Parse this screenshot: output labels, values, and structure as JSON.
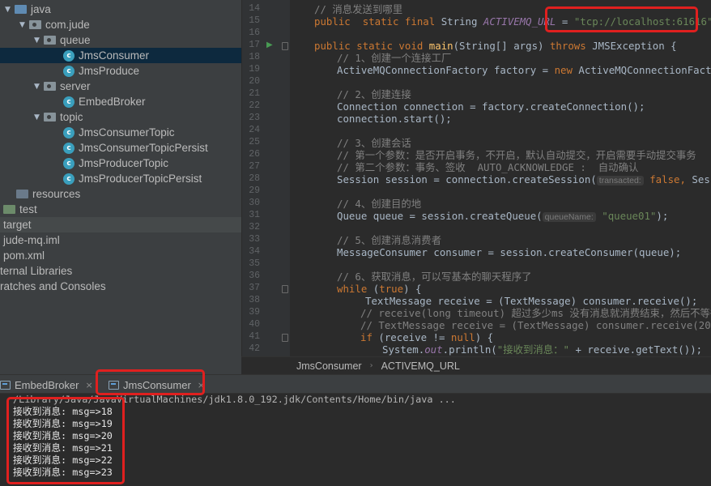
{
  "project_tree": [
    {
      "label": "java",
      "depth": 0,
      "icon": "source-folder-icon",
      "expanded": true
    },
    {
      "label": "com.jude",
      "depth": 1,
      "icon": "package-icon",
      "expanded": true
    },
    {
      "label": "queue",
      "depth": 2,
      "icon": "package-icon",
      "expanded": true
    },
    {
      "label": "JmsConsumer",
      "depth": 3,
      "icon": "java-class-icon",
      "selected": true
    },
    {
      "label": "JmsProduce",
      "depth": 3,
      "icon": "java-class-icon"
    },
    {
      "label": "server",
      "depth": 2,
      "icon": "package-icon",
      "expanded": true
    },
    {
      "label": "EmbedBroker",
      "depth": 3,
      "icon": "java-class-icon"
    },
    {
      "label": "topic",
      "depth": 2,
      "icon": "package-icon",
      "expanded": true
    },
    {
      "label": "JmsConsumerTopic",
      "depth": 3,
      "icon": "java-class-icon"
    },
    {
      "label": "JmsConsumerTopicPersist",
      "depth": 3,
      "icon": "java-class-icon"
    },
    {
      "label": "JmsProducerTopic",
      "depth": 3,
      "icon": "java-class-icon"
    },
    {
      "label": "JmsProducerTopicPersist",
      "depth": 3,
      "icon": "java-class-icon"
    },
    {
      "label": "resources",
      "depth": 0,
      "icon": "resources-folder-icon"
    },
    {
      "label": "test",
      "depth": -1,
      "icon": "test-folder-icon"
    },
    {
      "label": "target",
      "depth": -2
    },
    {
      "label": "jude-mq.iml",
      "depth": -2
    },
    {
      "label": "pom.xml",
      "depth": -2
    },
    {
      "label": "ternal Libraries",
      "depth": -3
    },
    {
      "label": "ratches and Consoles",
      "depth": -3
    }
  ],
  "editor": {
    "line_numbers": [
      "14",
      "15",
      "16",
      "17",
      "18",
      "19",
      "20",
      "21",
      "22",
      "23",
      "24",
      "25",
      "26",
      "27",
      "28",
      "29",
      "30",
      "31",
      "32",
      "33",
      "34",
      "35",
      "36",
      "37",
      "38",
      "39",
      "40",
      "41",
      "42"
    ],
    "code": {
      "l14": "// 消息发送到哪里",
      "l15_kw1": "public",
      "l15_kw2": "static final",
      "l15_type": "String",
      "l15_const": "ACTIVEMQ_URL",
      "l15_eq": " = ",
      "l15_str": "\"tcp://localhost:61616\"",
      "l15_end": ";",
      "l17_kw": "public static void",
      "l17_fn": "main",
      "l17_rest": "(String[] args)",
      "l17_throws": "throws",
      "l17_exc": "JMSException {",
      "l18": "// 1、创建一个连接工厂",
      "l19_a": "ActiveMQConnectionFactory factory = ",
      "l19_new": "new",
      "l19_b": " ActiveMQConnectionFactory(",
      "l21": "// 2、创建连接",
      "l22": "Connection connection = factory.createConnection();",
      "l23": "connection.start();",
      "l25": "// 3、创建会话",
      "l26": "// 第一个参数：是否开启事务，不开启，默认自动提交，开启需要手动提交事务",
      "l27": "// 第二个参数：事务、签收  AUTO_ACKNOWLEDGE :  自动确认",
      "l28_a": "Session session = connection.createSession(",
      "l28_hint": "transacted:",
      "l28_kw": "false,",
      "l28_b": " Sessio",
      "l30": "// 4、创建目的地",
      "l31_a": "Queue queue = session.createQueue(",
      "l31_hint": "queueName:",
      "l31_str": "\"queue01\"",
      "l31_b": ");",
      "l33": "// 5、创建消息消费者",
      "l34": "MessageConsumer consumer = session.createConsumer(queue);",
      "l36": "// 6、获取消息，可以写基本的聊天程序了",
      "l37_kw": "while",
      "l37_a": " (",
      "l37_true": "true",
      "l37_b": ") {",
      "l38": "TextMessage receive = (TextMessage) consumer.receive();",
      "l39": "// receive(long timeout) 超过多少ms 没有消息就消费结束，然后不等待了",
      "l40": "// TextMessage receive = (TextMessage) consumer.receive(2000);",
      "l41_kw": "if",
      "l41_a": " (receive != ",
      "l41_null": "null",
      "l41_b": ") {",
      "l42_a": "System.",
      "l42_out": "out",
      "l42_b": ".println(",
      "l42_str": "\"接收到消息：\"",
      "l42_c": " + receive.getText());"
    }
  },
  "breadcrumb": [
    "JmsConsumer",
    "ACTIVEMQ_URL"
  ],
  "run_tabs": [
    {
      "label": "EmbedBroker",
      "icon": "run-config-icon"
    },
    {
      "label": "JmsConsumer",
      "icon": "run-config-icon",
      "active": true
    }
  ],
  "console": {
    "command": "/Library/Java/JavaVirtualMachines/jdk1.8.0_192.jdk/Contents/Home/bin/java ...",
    "lines": [
      "接收到消息: msg=>18",
      "接收到消息: msg=>19",
      "接收到消息: msg=>20",
      "接收到消息: msg=>21",
      "接收到消息: msg=>22",
      "接收到消息: msg=>23"
    ]
  },
  "colors": {
    "highlight_box": "#e0201f",
    "selection": "#0d293e",
    "keyword": "#cc7832",
    "string": "#6a8759",
    "comment": "#808080"
  }
}
